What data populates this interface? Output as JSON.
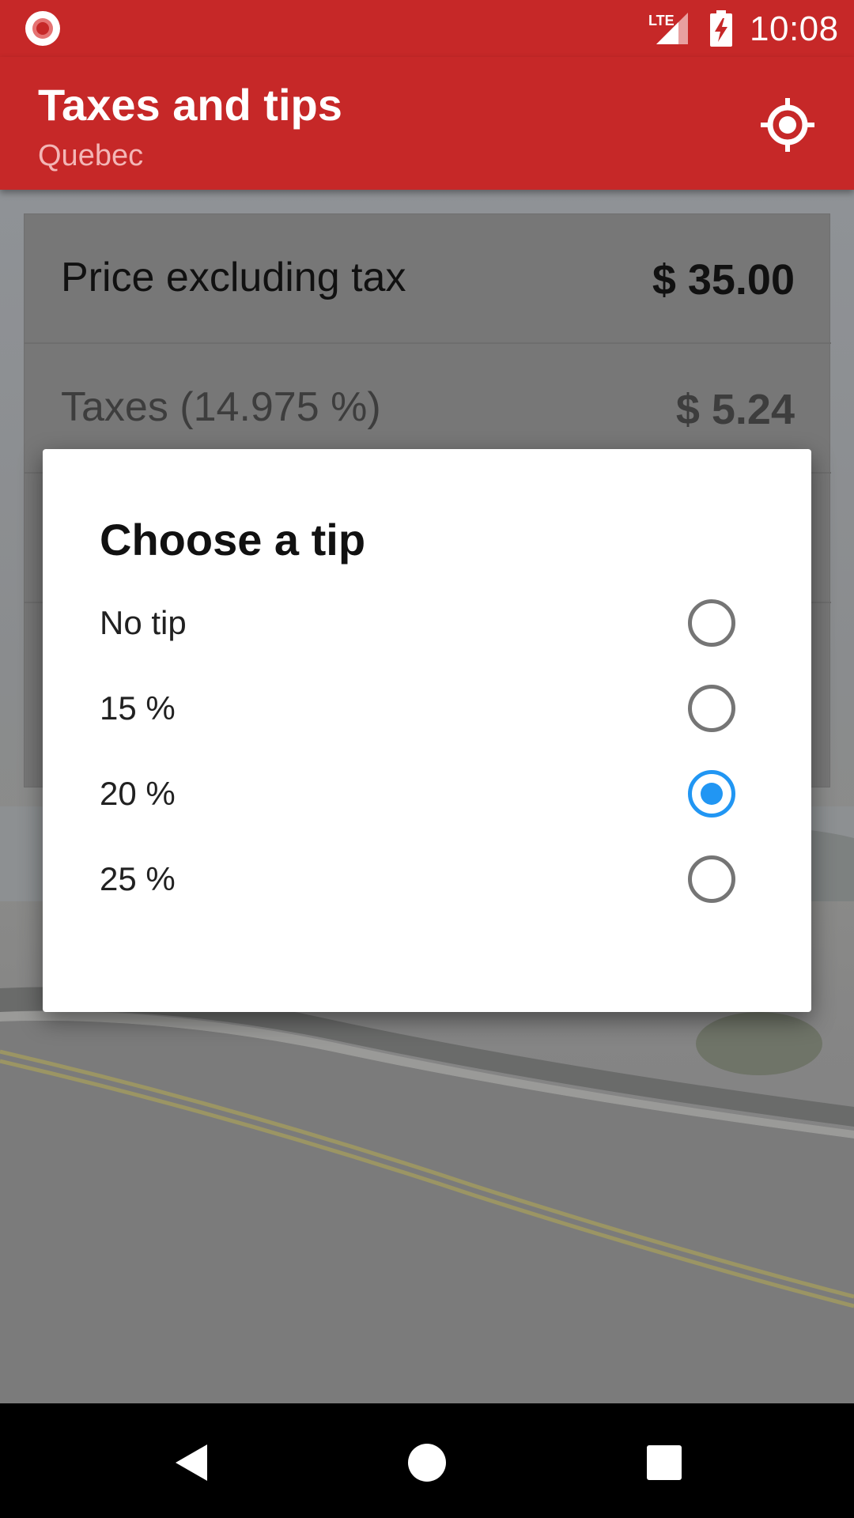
{
  "status_bar": {
    "time": "10:08",
    "network": "LTE",
    "icons": [
      "record-icon",
      "lte-signal-icon",
      "battery-charging-icon"
    ]
  },
  "app_bar": {
    "title": "Taxes and tips",
    "subtitle": "Quebec",
    "action_icon": "my-location-icon",
    "color": "#c62828"
  },
  "card": {
    "rows": [
      {
        "label": "Price excluding tax",
        "value": "$ 35.00"
      },
      {
        "label": "Taxes (14.975 %)",
        "value": "$ 5.24"
      }
    ]
  },
  "dialog": {
    "title": "Choose a tip",
    "options": [
      {
        "label": "No tip",
        "selected": false
      },
      {
        "label": "15 %",
        "selected": false
      },
      {
        "label": "20 %",
        "selected": true
      },
      {
        "label": "25 %",
        "selected": false
      }
    ],
    "accent_color": "#2196f3"
  },
  "nav_bar": {
    "buttons": [
      "back-icon",
      "home-icon",
      "recents-icon"
    ]
  }
}
